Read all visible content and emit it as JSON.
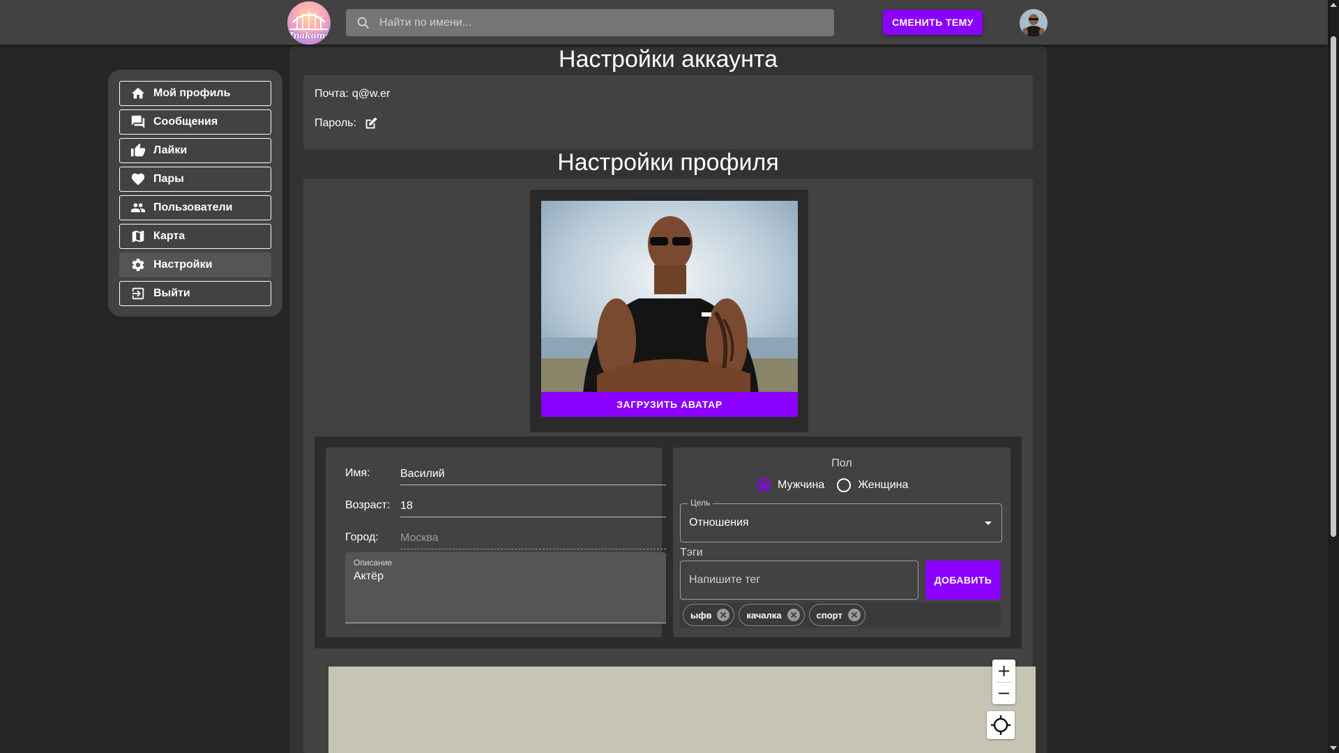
{
  "header": {
    "logo_text": "Znakomstva",
    "search_placeholder": "Найти по имени...",
    "theme_button": "СМЕНИТЬ ТЕМУ"
  },
  "sidebar": {
    "items": [
      {
        "label": "Мой профиль",
        "icon": "home-icon"
      },
      {
        "label": "Сообщения",
        "icon": "chat-icon"
      },
      {
        "label": "Лайки",
        "icon": "thumb-up-icon"
      },
      {
        "label": "Пары",
        "icon": "heart-icon"
      },
      {
        "label": "Пользователи",
        "icon": "people-icon"
      },
      {
        "label": "Карта",
        "icon": "map-icon"
      },
      {
        "label": "Настройки",
        "icon": "gear-icon",
        "active": true
      },
      {
        "label": "Выйти",
        "icon": "logout-icon"
      }
    ]
  },
  "account": {
    "title": "Настройки аккаунта",
    "email_label": "Почта:",
    "email_value": "q@w.er",
    "password_label": "Пароль:"
  },
  "profile": {
    "title": "Настройки профиля",
    "upload_button": "ЗАГРУЗИТЬ АВАТАР",
    "name_label": "Имя:",
    "name_value": "Василий",
    "age_label": "Возраст:",
    "age_value": "18",
    "city_label": "Город:",
    "city_placeholder": "Москва",
    "description_label": "Описание",
    "description_value": "Актёр",
    "gender_title": "Пол",
    "gender_options": [
      "Мужчина",
      "Женщина"
    ],
    "gender_selected": "Мужчина",
    "goal_label": "Цель",
    "goal_value": "Отношения",
    "tags_title": "Тэги",
    "tag_placeholder": "Напишите тег",
    "add_button": "ДОБАВИТЬ",
    "tags": [
      "ыфв",
      "качалка",
      "спорт"
    ]
  },
  "map": {
    "zoom_in": "+",
    "zoom_out": "−"
  },
  "colors": {
    "accent": "#8a00ff",
    "page_bg": "#262626",
    "panel_bg": "#424242"
  }
}
